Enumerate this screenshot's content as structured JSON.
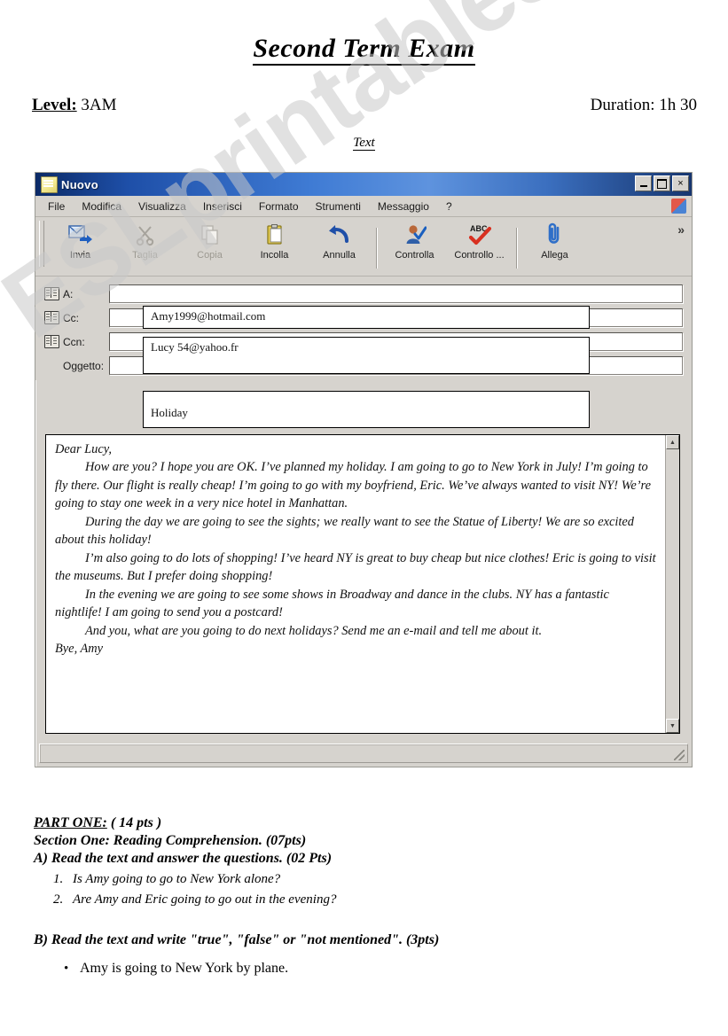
{
  "header": {
    "title": "Second Term Exam",
    "level_label": "Level:",
    "level_value": " 3AM",
    "duration": "Duration: 1h 30",
    "text_label": "Text"
  },
  "email_window": {
    "title": "Nuovo",
    "window_buttons": {
      "minimize": "minimize-icon",
      "maximize": "maximize-icon",
      "close": "×"
    },
    "menu": [
      "File",
      "Modifica",
      "Visualizza",
      "Inserisci",
      "Formato",
      "Strumenti",
      "Messaggio",
      "?"
    ],
    "toolbar": [
      {
        "label": "Invia",
        "icon": "send-icon",
        "disabled": false
      },
      {
        "label": "Taglia",
        "icon": "scissors-icon",
        "disabled": true
      },
      {
        "label": "Copia",
        "icon": "copy-icon",
        "disabled": true
      },
      {
        "label": "Incolla",
        "icon": "paste-icon",
        "disabled": false
      },
      {
        "label": "Annulla",
        "icon": "undo-icon",
        "disabled": false
      },
      {
        "label": "Controlla",
        "icon": "check-names-icon",
        "disabled": false
      },
      {
        "label": "Controllo ...",
        "icon": "spellcheck-icon",
        "disabled": false
      },
      {
        "label": "Allega",
        "icon": "paperclip-icon",
        "disabled": false
      }
    ],
    "toolbar_overflow": "»",
    "fields": [
      {
        "label": "A:",
        "value": "Amy1999@hotmail.com"
      },
      {
        "label": "Cc:",
        "value": "Lucy 54@yahoo.fr"
      },
      {
        "label": "Ccn:",
        "value": ""
      },
      {
        "label": "Oggetto:",
        "value": "Holiday"
      }
    ],
    "body": {
      "greeting": "Dear Lucy,",
      "paragraphs": [
        "How are you? I hope you are OK. I’ve planned my holiday. I am going to go to New York in July! I’m going to fly there. Our flight is really cheap! I’m going to go with my boyfriend, Eric. We’ve always wanted to visit NY! We’re going to stay one week in a very nice hotel in Manhattan.",
        "During the day we are going to see the sights; we really want to see the Statue of Liberty! We are so excited about this holiday!",
        "I’m also going to do lots of shopping! I’ve heard NY is great to buy cheap but nice clothes! Eric is going to visit the museums. But I prefer doing shopping!",
        "In the evening we are going to see some shows in Broadway and dance in the clubs. NY has a fantastic nightlife! I am going to send you a postcard!",
        "And you, what are you going to do next holidays? Send me an e-mail and tell me about it."
      ],
      "signoff": "Bye, Amy"
    }
  },
  "questions": {
    "part_label": "PART ONE:",
    "part_points": " ( 14 pts )",
    "section_label": "Section One:",
    "section_title": " Reading Comprehension. (07pts)",
    "task_a": "A)  Read the text and answer the questions. (02 Pts)",
    "task_a_items": [
      {
        "num": "1.",
        "text": "Is Amy going to go to New York alone?"
      },
      {
        "num": "2.",
        "text": "Are Amy and Eric going to go out in the evening?"
      }
    ],
    "task_b": "B) Read the text and write \"true\", \"false\" or \"not mentioned\". (3pts)",
    "task_b_items": [
      {
        "bullet": "•",
        "text": "Amy is going to New York by plane."
      }
    ]
  },
  "watermark": {
    "text": "ESLprintables.com",
    "color": "#c9c9c9"
  }
}
